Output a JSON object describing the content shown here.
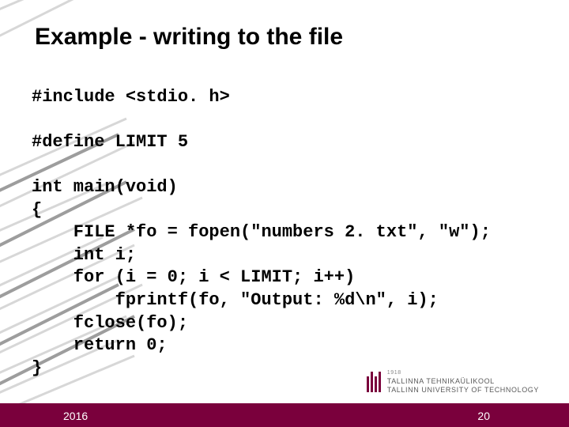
{
  "title": "Example - writing to the file",
  "code": {
    "l1": "#include <stdio. h>",
    "l2": "#define LIMIT 5",
    "l3": "int main(void)",
    "l4": "{",
    "l5": "    FILE *fo = fopen(\"numbers 2. txt\", \"w\");",
    "l6": "    int i;",
    "l7": "    for (i = 0; i < LIMIT; i++)",
    "l8": "        fprintf(fo, \"Output: %d\\n\", i);",
    "l9": "    fclose(fo);",
    "l10": "    return 0;",
    "l11": "}"
  },
  "footer": {
    "year": "2016",
    "page": "20"
  },
  "logo": {
    "year": "1918",
    "line1": "TALLINNA TEHNIKAÜLIKOOL",
    "line2": "TALLINN UNIVERSITY OF TECHNOLOGY"
  }
}
